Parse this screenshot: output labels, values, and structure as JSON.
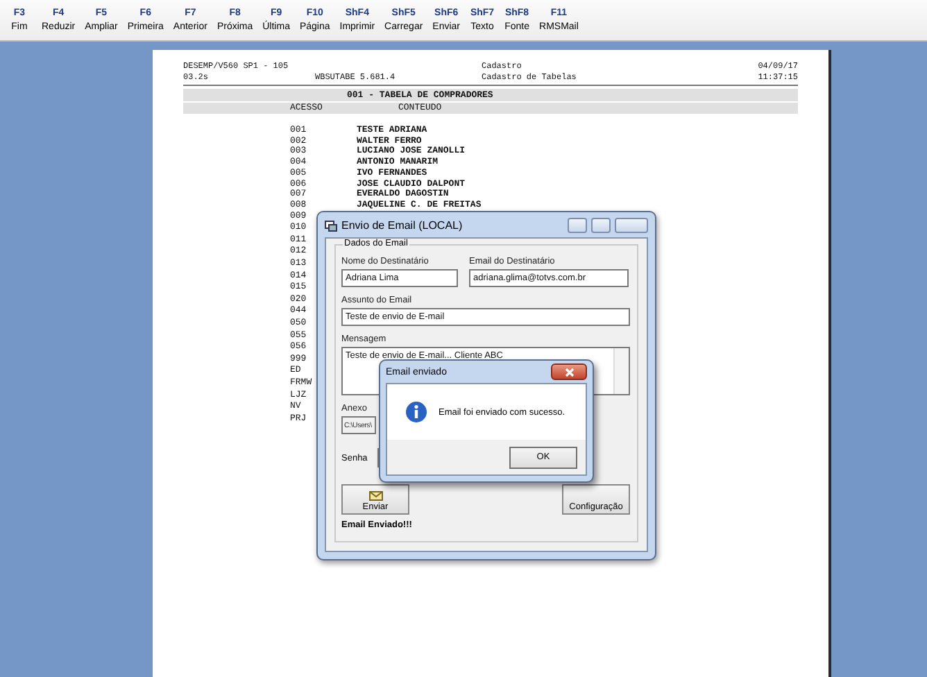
{
  "toolbar": [
    {
      "key": "F3",
      "label": "Fim"
    },
    {
      "key": "F4",
      "label": "Reduzir"
    },
    {
      "key": "F5",
      "label": "Ampliar"
    },
    {
      "key": "F6",
      "label": "Primeira"
    },
    {
      "key": "F7",
      "label": "Anterior"
    },
    {
      "key": "F8",
      "label": "Próxima"
    },
    {
      "key": "F9",
      "label": "Última"
    },
    {
      "key": "F10",
      "label": "Página"
    },
    {
      "key": "ShF4",
      "label": "Imprimir"
    },
    {
      "key": "ShF5",
      "label": "Carregar"
    },
    {
      "key": "ShF6",
      "label": "Enviar"
    },
    {
      "key": "ShF7",
      "label": "Texto"
    },
    {
      "key": "ShF8",
      "label": "Fonte"
    },
    {
      "key": "F11",
      "label": "RMSMail"
    }
  ],
  "report": {
    "header_lines": [
      {
        "left": "DESEMP/V560 SP1 - 105",
        "center": "Cadastro",
        "right": "04/09/17"
      },
      {
        "left": "03.2s",
        "middle": "WBSUTABE 5.681.4",
        "center": "Cadastro de Tabelas",
        "right": "11:37:15"
      }
    ],
    "title": "001 - TABELA DE COMPRADORES",
    "columns": [
      "ACESSO",
      "CONTEUDO"
    ],
    "rows": [
      {
        "code": "001",
        "name": "TESTE ADRIANA"
      },
      {
        "code": "002",
        "name": "WALTER FERRO"
      },
      {
        "code": "003",
        "name": "LUCIANO JOSE ZANOLLI"
      },
      {
        "code": "004",
        "name": "ANTONIO MANARIM"
      },
      {
        "code": "005",
        "name": "IVO FERNANDES"
      },
      {
        "code": "006",
        "name": "JOSE CLAUDIO DALPONT"
      },
      {
        "code": "007",
        "name": "EVERALDO DAGOSTIN"
      },
      {
        "code": "008",
        "name": "JAQUELINE C. DE FREITAS"
      },
      {
        "code": "009"
      },
      {
        "code": "010"
      },
      {
        "code": "011"
      },
      {
        "code": "012"
      },
      {
        "code": "013"
      },
      {
        "code": "014"
      },
      {
        "code": "015"
      },
      {
        "code": "020"
      },
      {
        "code": "044"
      },
      {
        "code": "050"
      },
      {
        "code": "055"
      },
      {
        "code": "056"
      },
      {
        "code": "999"
      },
      {
        "code": "ED"
      },
      {
        "code": "FRMW"
      },
      {
        "code": "LJZ"
      },
      {
        "code": "NV"
      },
      {
        "code": "PRJ"
      }
    ]
  },
  "email_dialog": {
    "title": "Envio de Email (LOCAL)",
    "group_label": "Dados do Email",
    "recipient_name": {
      "label": "Nome do Destinatário",
      "value": "Adriana Lima"
    },
    "recipient_email": {
      "label": "Email do Destinatário",
      "value": "adriana.glima@totvs.com.br"
    },
    "subject": {
      "label": "Assunto do Email",
      "value": "Teste de envio de E-mail"
    },
    "message": {
      "label": "Mensagem",
      "value": "Teste de envio de E-mail... Cliente ABC"
    },
    "attachment": {
      "label": "Anexo",
      "value": "C:\\Users\\"
    },
    "password": {
      "label": "Senha"
    },
    "send_button": "Enviar",
    "config_button": "Configuração",
    "status": "Email Enviado!!!"
  },
  "message_box": {
    "title": "Email enviado",
    "text": "Email foi enviado com sucesso.",
    "ok": "OK"
  }
}
